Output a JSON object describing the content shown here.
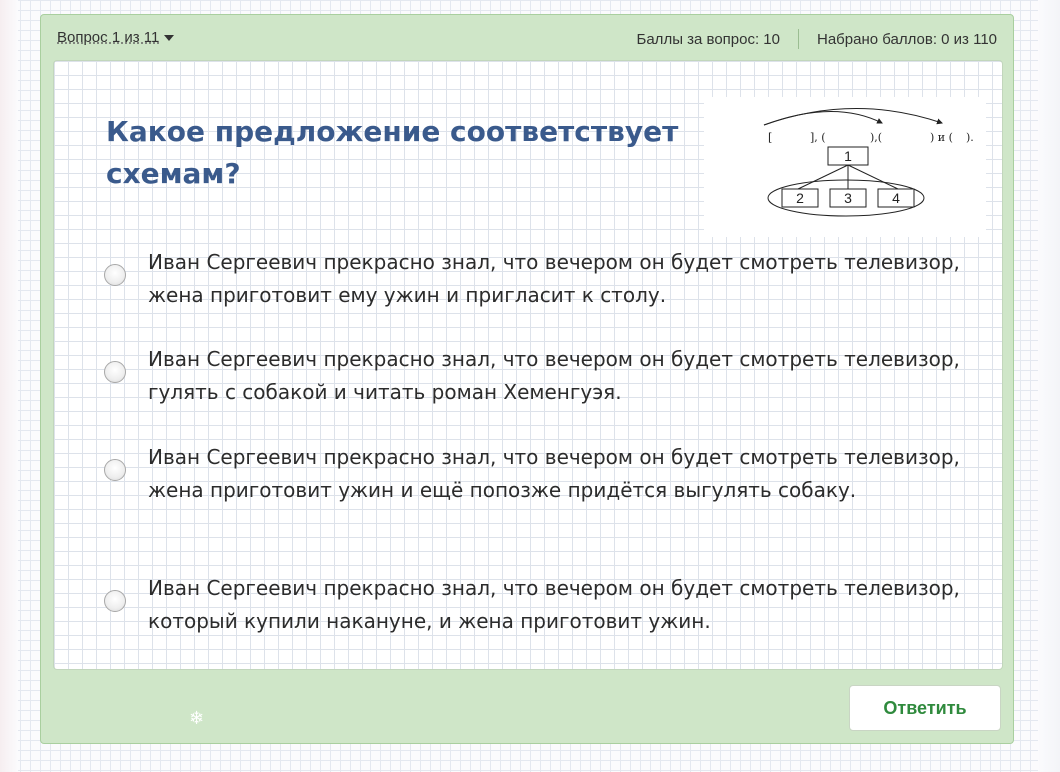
{
  "header": {
    "question_counter": "Вопрос 1 из 11",
    "points_per_question": "Баллы за вопрос: 10",
    "points_total": "Набрано баллов: 0 из 110"
  },
  "question": {
    "text": "Какое предложение соответствует схемам?"
  },
  "scheme": {
    "bracket_line": {
      "open_square": "[",
      "part1": "], (",
      "part2": "),(",
      "part3": ") и (",
      "part4": ")."
    },
    "main_box": "1",
    "sub_boxes": [
      "2",
      "3",
      "4"
    ]
  },
  "options": [
    {
      "text": "Иван Сергеевич прекрасно знал, что вечером он будет смотреть телевизор, жена приготовит ему ужин и пригласит к столу."
    },
    {
      "text": "Иван Сергеевич прекрасно знал, что вечером он будет смотреть телевизор, гулять с собакой и читать роман Хеменгуэя."
    },
    {
      "text": "Иван Сергеевич прекрасно знал, что вечером он будет смотреть телевизор, жена приготовит ужин и ещё попозже придётся выгулять собаку."
    },
    {
      "text": "Иван Сергеевич прекрасно знал, что вечером он будет смотреть телевизор, который купили накануне, и жена приготовит ужин."
    }
  ],
  "actions": {
    "submit_label": "Ответить"
  },
  "colors": {
    "frame_green": "#cfe6c8",
    "question_blue": "#3a5a8c",
    "submit_green": "#2f8a3d"
  }
}
